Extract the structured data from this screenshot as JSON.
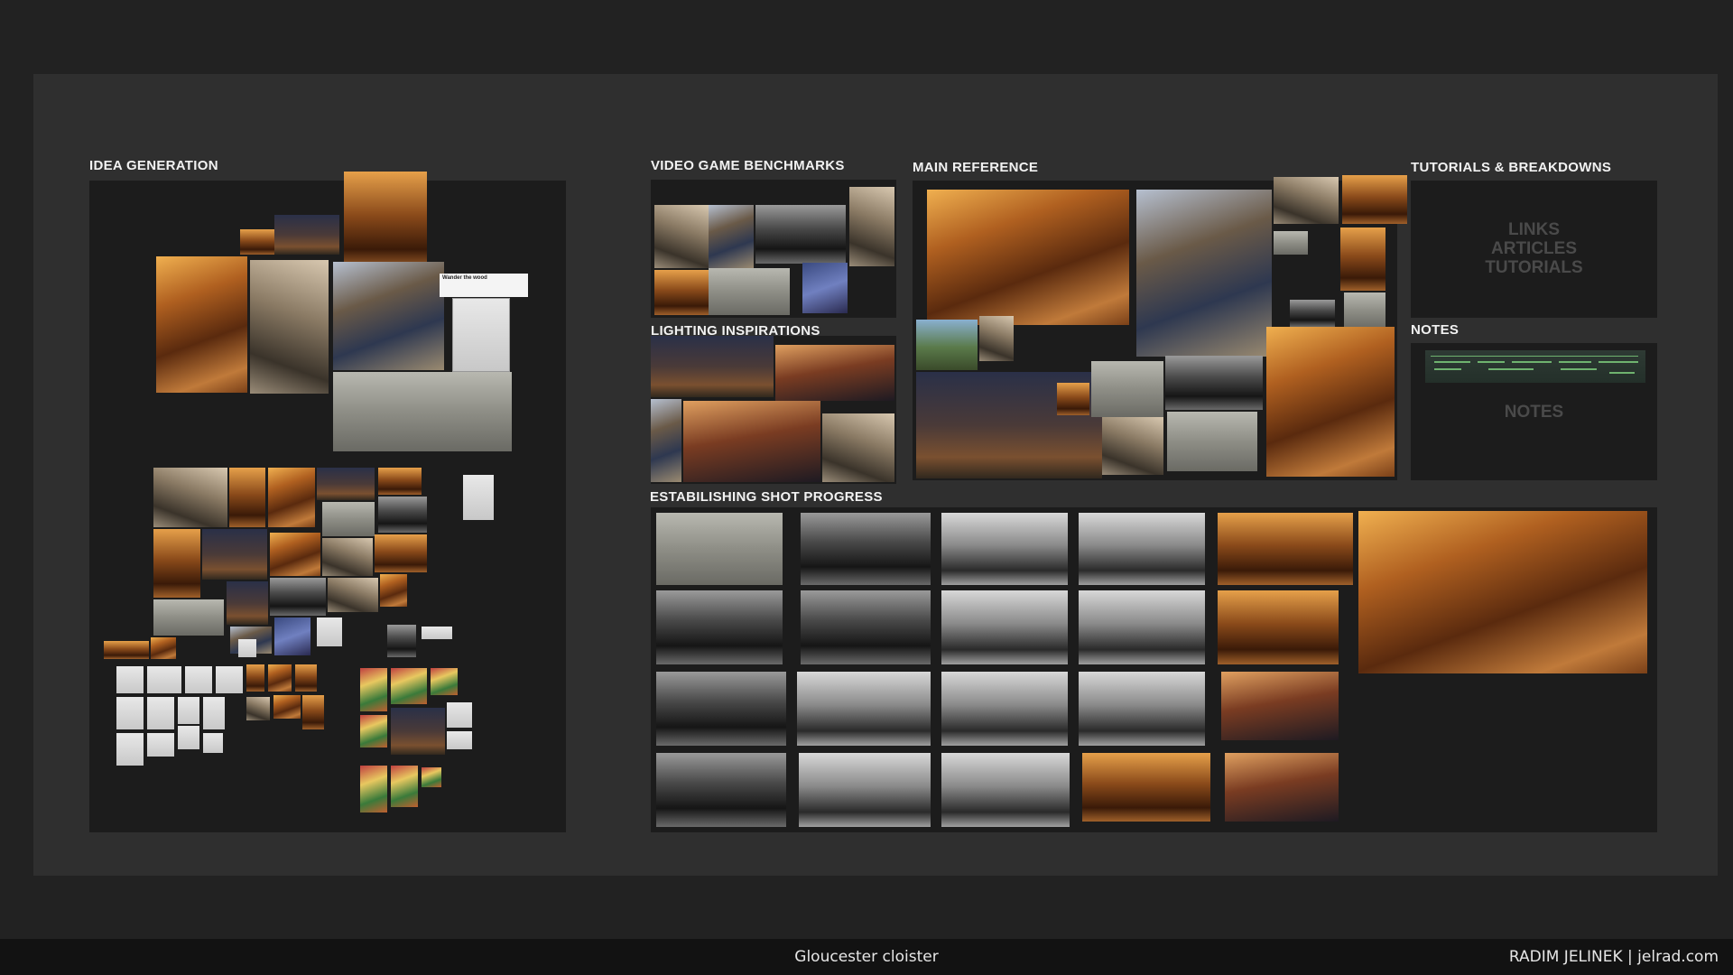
{
  "sections": {
    "idea_generation": "IDEA GENERATION",
    "video_game_benchmarks": "VIDEO GAME BENCHMARKS",
    "lighting_inspirations": "LIGHTING INSPIRATIONS",
    "main_reference": "MAIN REFERENCE",
    "tutorials_breakdowns": "TUTORIALS & BREAKDOWNS",
    "notes": "NOTES",
    "establishing_shot_progress": "ESTABILISHING SHOT PROGRESS"
  },
  "tutorials_placeholder": {
    "line1": "LINKS",
    "line2": "ARTICLES",
    "line3": "TUTORIALS"
  },
  "notes_placeholder": "NOTES",
  "idea_note": {
    "title": "Wander the wood"
  },
  "footer": {
    "project_title": "Gloucester cloister",
    "author_credit": "RADIM JELINEK | jelrad.com"
  },
  "colors": {
    "background": "#222222",
    "board": "#2f2f2f",
    "panel": "#1c1c1c",
    "title_text": "#f2f2f2",
    "placeholder_text": "#4a4a4a",
    "footer": "#121212"
  }
}
